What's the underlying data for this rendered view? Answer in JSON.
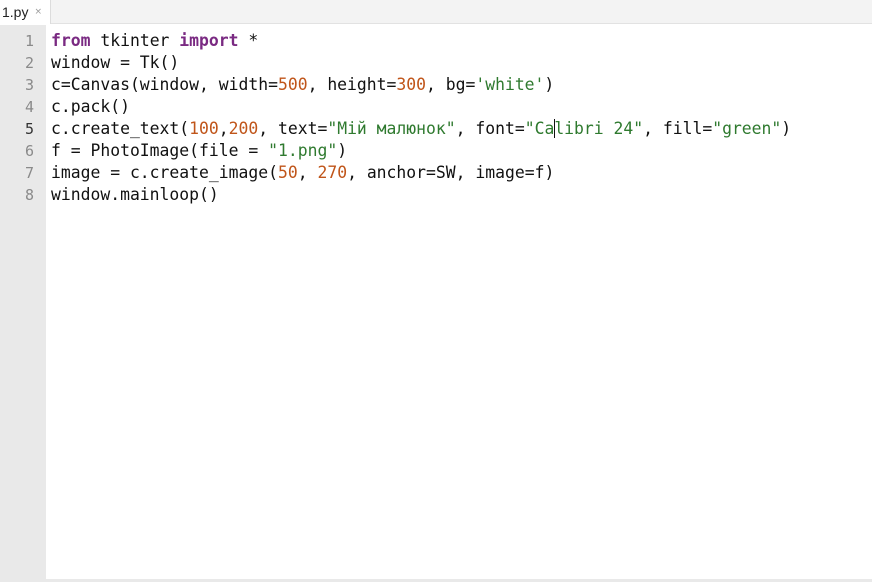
{
  "tab": {
    "title": "1.py",
    "close_glyph": "×"
  },
  "gutter": {
    "numbers": [
      "1",
      "2",
      "3",
      "4",
      "5",
      "6",
      "7",
      "8"
    ],
    "active_line": "5"
  },
  "code": {
    "line1": {
      "kw_from": "from",
      "t1": " tkinter ",
      "kw_import": "import",
      "t2": " *"
    },
    "line2": {
      "t1": "window = Tk()"
    },
    "line3": {
      "t1": "c=Canvas(window, width=",
      "n1": "500",
      "t2": ", height=",
      "n2": "300",
      "t3": ", bg=",
      "s1": "'white'",
      "t4": ")"
    },
    "line4": {
      "t1": "c.pack()"
    },
    "line5": {
      "t1": "c.create_text(",
      "n1": "100",
      "t2": ",",
      "n2": "200",
      "t3": ", text=",
      "s1": "\"Мій малюнок\"",
      "t4": ", font=",
      "s2a": "\"Ca",
      "s2b": "libri 24\"",
      "t5": ", fill=",
      "s3": "\"green\"",
      "t6": ")"
    },
    "line6": {
      "t1": "f = PhotoImage(file = ",
      "s1": "\"1.png\"",
      "t2": ")"
    },
    "line7": {
      "t1": "image = c.create_image(",
      "n1": "50",
      "t2": ", ",
      "n2": "270",
      "t3": ", anchor=SW, image=f)"
    },
    "line8": {
      "t1": "window.mainloop()"
    }
  },
  "colors": {
    "keyword": "#7a2a82",
    "number": "#c0551a",
    "string": "#2f7a2f",
    "gutter_bg": "#e9e9e9",
    "text": "#111111"
  }
}
